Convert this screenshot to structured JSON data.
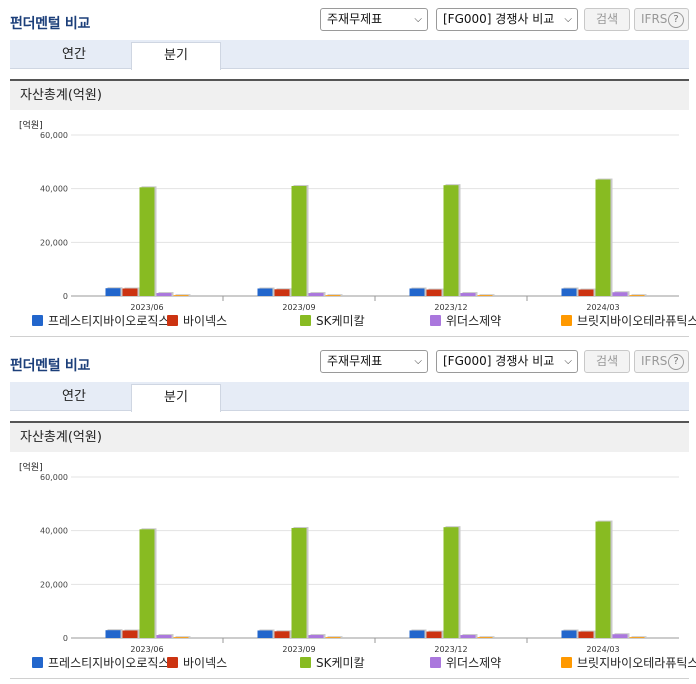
{
  "header": {
    "title": "펀더멘털 비교",
    "statement_select": "주재무제표",
    "peer_select": "[FG000] 경쟁사 비교",
    "search_label": "검색",
    "ifrs_label": "IFRS",
    "help_label": "?"
  },
  "tabs": [
    {
      "label": "연간",
      "active": false
    },
    {
      "label": "분기",
      "active": true
    }
  ],
  "section": {
    "title": "자산총계(억원)"
  },
  "chart_data": {
    "type": "bar",
    "unit_label": "[억원]",
    "categories": [
      "2023/06",
      "2023/09",
      "2023/12",
      "2024/03"
    ],
    "ylim": [
      0,
      60000
    ],
    "yticks": [
      "60,000",
      "40,000",
      "20,000",
      "0"
    ],
    "ytick_values": [
      60000,
      40000,
      20000,
      0
    ],
    "series": [
      {
        "name": "프레스티지바이오로직스",
        "color": "#2266cc",
        "values": [
          2900,
          2800,
          2800,
          2800
        ]
      },
      {
        "name": "바이넥스",
        "color": "#cc3311",
        "values": [
          2800,
          2500,
          2400,
          2400
        ]
      },
      {
        "name": "SK케미칼",
        "color": "#88bb22",
        "values": [
          40500,
          41000,
          41300,
          43400
        ]
      },
      {
        "name": "위더스제약",
        "color": "#aa77dd",
        "values": [
          1100,
          1100,
          1100,
          1400
        ]
      },
      {
        "name": "브릿지바이오테라퓨틱스",
        "color": "#ff9900",
        "values": [
          300,
          300,
          300,
          300
        ]
      }
    ]
  }
}
